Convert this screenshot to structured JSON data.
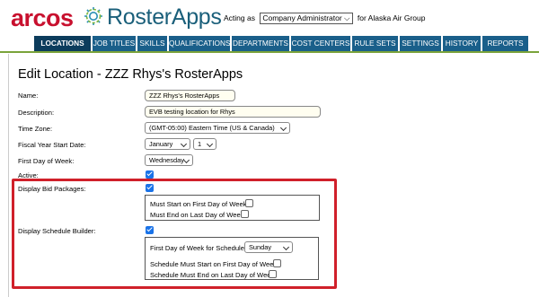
{
  "header": {
    "logo_text": "arcos",
    "app_name": "RosterApps",
    "acting_prefix": "Acting as",
    "acting_role": "Company Administrator",
    "acting_suffix": "for Alaska Air Group"
  },
  "nav": {
    "tabs": [
      {
        "label": "LOCATIONS",
        "active": true
      },
      {
        "label": "JOB TITLES"
      },
      {
        "label": "SKILLS"
      },
      {
        "label": "QUALIFICATIONS"
      },
      {
        "label": "DEPARTMENTS"
      },
      {
        "label": "COST CENTERS"
      },
      {
        "label": "RULE SETS"
      },
      {
        "label": "SETTINGS"
      },
      {
        "label": "HISTORY"
      },
      {
        "label": "REPORTS"
      }
    ]
  },
  "page": {
    "title": "Edit Location - ZZZ Rhys's RosterApps"
  },
  "form": {
    "name_label": "Name:",
    "name_value": "ZZZ Rhys's RosterApps",
    "description_label": "Description:",
    "description_value": "EVB testing location for Rhys",
    "timezone_label": "Time Zone:",
    "timezone_value": "(GMT-05:00) Eastern Time (US & Canada)",
    "fiscal_label": "Fiscal Year Start Date:",
    "fiscal_month": "January",
    "fiscal_day": "1",
    "first_day_label": "First Day of Week:",
    "first_day_value": "Wednesday",
    "active_label": "Active:",
    "active_checked": true,
    "bid_label": "Display Bid Packages:",
    "bid_checked": true,
    "bid_must_start_label": "Must Start on First Day of Week:",
    "bid_must_start_checked": false,
    "bid_must_end_label": "Must End on Last Day of Week:",
    "bid_must_end_checked": false,
    "schedule_label": "Display Schedule Builder:",
    "schedule_checked": true,
    "schedule_first_day_label": "First Day of Week for Schedules:",
    "schedule_first_day_value": "Sunday",
    "schedule_must_start_label": "Schedule Must Start on First Day of Week:",
    "schedule_must_start_checked": false,
    "schedule_must_end_label": "Schedule Must End on Last Day of Week:",
    "schedule_must_end_checked": false
  },
  "colors": {
    "brand_red": "#c8102e",
    "brand_teal": "#1a5f7a",
    "nav_blue": "#1a5f8a",
    "nav_active": "#0c3c5c",
    "checkbox_blue": "#1a73e8",
    "highlight_red": "#d0202a"
  }
}
